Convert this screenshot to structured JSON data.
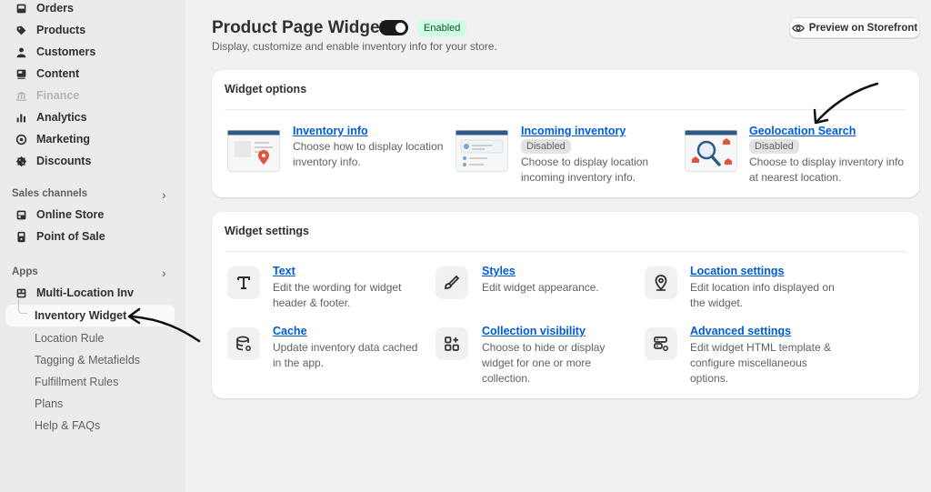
{
  "sidebar": {
    "items": [
      {
        "label": "Orders",
        "icon": "inbox-icon"
      },
      {
        "label": "Products",
        "icon": "tag-icon"
      },
      {
        "label": "Customers",
        "icon": "person-icon"
      },
      {
        "label": "Content",
        "icon": "content-icon"
      },
      {
        "label": "Finance",
        "icon": "bank-icon"
      },
      {
        "label": "Analytics",
        "icon": "bar-chart-icon"
      },
      {
        "label": "Marketing",
        "icon": "target-icon"
      },
      {
        "label": "Discounts",
        "icon": "discount-icon"
      }
    ],
    "sales_channels_label": "Sales channels",
    "sales_channels": [
      {
        "label": "Online Store",
        "icon": "store-icon"
      },
      {
        "label": "Point of Sale",
        "icon": "pos-icon"
      }
    ],
    "apps_label": "Apps",
    "app_name": "Multi-Location Inv",
    "active_sub": "Inventory Widget",
    "sub_items": [
      "Location Rule",
      "Tagging & Metafields",
      "Fulfillment Rules",
      "Plans",
      "Help & FAQs"
    ]
  },
  "header": {
    "title": "Product Page Widget",
    "status": "Enabled",
    "subtitle": "Display, customize and enable inventory info for your store.",
    "preview_label": "Preview on Storefront"
  },
  "widget_options": {
    "title": "Widget options",
    "items": [
      {
        "title": "Inventory info",
        "badge": "",
        "desc1": "Choose how to display location",
        "desc2": "inventory info."
      },
      {
        "title": "Incoming inventory",
        "badge": "Disabled",
        "desc1": "Choose to display location",
        "desc2": "incoming inventory info."
      },
      {
        "title": "Geolocation Search",
        "badge": "Disabled",
        "desc1": "Choose to display inventory info",
        "desc2": "at nearest location."
      }
    ]
  },
  "widget_settings": {
    "title": "Widget settings",
    "items": [
      {
        "title": "Text",
        "icon": "text-icon",
        "lines": [
          "Edit the wording for widget",
          "header & footer."
        ]
      },
      {
        "title": "Styles",
        "icon": "brush-icon",
        "lines": [
          "Edit widget appearance."
        ]
      },
      {
        "title": "Location settings",
        "icon": "location-pin-icon",
        "lines": [
          "Edit location info displayed on",
          "the widget."
        ]
      },
      {
        "title": "Cache",
        "icon": "database-icon",
        "lines": [
          "Update inventory data cached",
          "in the app."
        ]
      },
      {
        "title": "Collection visibility",
        "icon": "apps-grid-icon",
        "lines": [
          "Choose to hide or display",
          "widget for one or more",
          "collection."
        ]
      },
      {
        "title": "Advanced settings",
        "icon": "server-settings-icon",
        "lines": [
          "Edit widget HTML template &",
          "configure miscellaneous",
          "options."
        ]
      }
    ]
  },
  "colors": {
    "link": "#005bd3",
    "enabled_badge_bg": "#cdfee1",
    "toggle_on": "#1a1a1a"
  }
}
